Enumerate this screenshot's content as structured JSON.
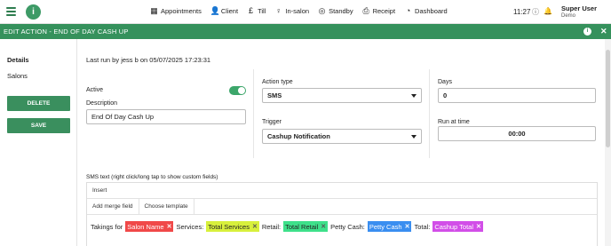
{
  "topbar": {
    "logo": "i",
    "nav": [
      {
        "icon": "calendar-icon",
        "glyph": "▦",
        "label": "Appointments"
      },
      {
        "icon": "person-icon",
        "glyph": "👤",
        "label": "Client"
      },
      {
        "icon": "pound-icon",
        "glyph": "£",
        "label": "Till"
      },
      {
        "icon": "figure-icon",
        "glyph": "♀",
        "label": "In-salon"
      },
      {
        "icon": "standby-icon",
        "glyph": "◎",
        "label": "Standby"
      },
      {
        "icon": "printer-icon",
        "glyph": "⎙",
        "label": "Receipt"
      },
      {
        "icon": "dashboard-icon",
        "glyph": "◔",
        "label": "Dashboard"
      }
    ],
    "time": "11:27",
    "user_name": "Super User",
    "user_sub": "Demo"
  },
  "header": {
    "title": "EDIT ACTION - END OF DAY CASH UP",
    "info": "i",
    "close": "✕"
  },
  "leftnav": {
    "items": [
      "Details",
      "Salons"
    ],
    "delete_label": "DELETE",
    "save_label": "SAVE"
  },
  "form": {
    "last_run": "Last run by jess b on 05/07/2025 17:23:31",
    "active_label": "Active",
    "active": true,
    "description_label": "Description",
    "description_value": "End Of Day Cash Up",
    "action_type_label": "Action type",
    "action_type_value": "SMS",
    "trigger_label": "Trigger",
    "trigger_value": "Cashup Notification",
    "days_label": "Days",
    "days_value": "0",
    "run_at_label": "Run at time",
    "run_at_value": "00:00"
  },
  "sms": {
    "label": "SMS text (right click/long tap to show custom fields)",
    "insert": "Insert",
    "add_merge": "Add merge field",
    "choose_template": "Choose template",
    "parts": [
      {
        "text": "Takings for"
      },
      {
        "tag": "Salon Name",
        "color": "#f04848",
        "textColor": "#fff"
      },
      {
        "text": "Services:"
      },
      {
        "tag": "Total Services",
        "color": "#d8f03c",
        "textColor": "#222"
      },
      {
        "text": "Retail:"
      },
      {
        "tag": "Total Retail",
        "color": "#3ee08a",
        "textColor": "#222"
      },
      {
        "text": "Petty Cash:"
      },
      {
        "tag": "Petty Cash",
        "color": "#3a8ef0",
        "textColor": "#fff"
      },
      {
        "text": "Total:"
      },
      {
        "tag": "Cashup Total",
        "color": "#d24ee8",
        "textColor": "#fff"
      }
    ]
  },
  "colors": {
    "brand": "#35915c",
    "button": "#3a8f5e"
  }
}
